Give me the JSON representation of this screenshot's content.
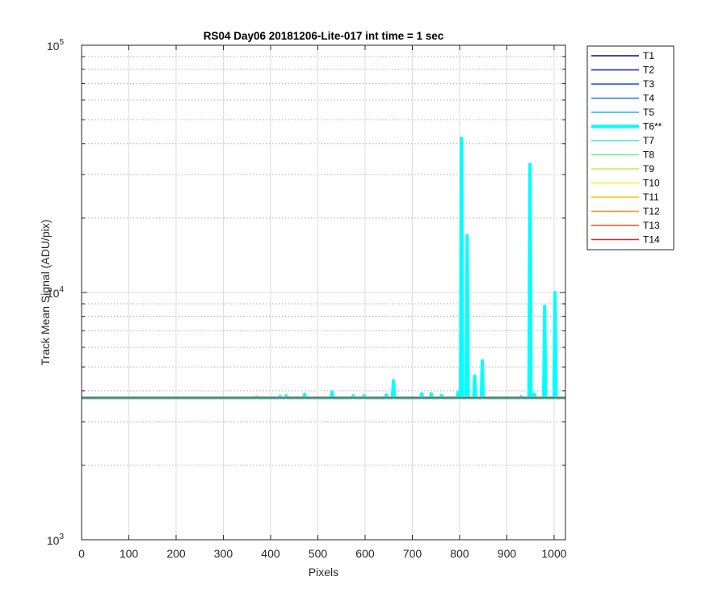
{
  "chart_data": {
    "type": "line",
    "title": "RS04 Day06 20181206-Lite-017 int time = 1 sec",
    "xlabel": "Pixels",
    "ylabel": "Track Mean Signal (ADU/pix)",
    "xlim": [
      0,
      1024
    ],
    "ylim": [
      1000,
      100000
    ],
    "yscale": "log",
    "grid": true,
    "minor_grid": true,
    "legend_position": "outside-right",
    "x_ticks": [
      "0",
      "100",
      "200",
      "300",
      "400",
      "500",
      "600",
      "700",
      "800",
      "900",
      "1000"
    ],
    "y_ticks": [
      {
        "base": "10",
        "exp": "3",
        "value": 1000
      },
      {
        "base": "10",
        "exp": "4",
        "value": 10000
      },
      {
        "base": "10",
        "exp": "5",
        "value": 100000
      }
    ],
    "baseline_level": 3750,
    "series": [
      {
        "name": "T1",
        "color": "#0b0b8f",
        "width": 1.5,
        "values": "baseline"
      },
      {
        "name": "T2",
        "color": "#1020c8",
        "width": 1.5,
        "values": "baseline"
      },
      {
        "name": "T3",
        "color": "#1a4fdc",
        "width": 1.5,
        "values": "baseline"
      },
      {
        "name": "T4",
        "color": "#1f82e6",
        "width": 1.5,
        "values": "baseline"
      },
      {
        "name": "T5",
        "color": "#25b4ef",
        "width": 1.5,
        "values": "baseline"
      },
      {
        "name": "T6**",
        "color": "#00ffff",
        "width": 4,
        "peaks": [
          [
            370,
            3780
          ],
          [
            420,
            3800
          ],
          [
            433,
            3820
          ],
          [
            472,
            3880
          ],
          [
            530,
            3960
          ],
          [
            575,
            3820
          ],
          [
            598,
            3830
          ],
          [
            645,
            3860
          ],
          [
            660,
            4400
          ],
          [
            720,
            3900
          ],
          [
            740,
            3900
          ],
          [
            762,
            3840
          ],
          [
            797,
            3950
          ],
          [
            804,
            42000
          ],
          [
            816,
            17000
          ],
          [
            832,
            4600
          ],
          [
            848,
            5300
          ],
          [
            930,
            3790
          ],
          [
            949,
            33000
          ],
          [
            958,
            3880
          ],
          [
            980,
            8800
          ],
          [
            1002,
            10000
          ]
        ]
      },
      {
        "name": "T7",
        "color": "#3fe0c8",
        "width": 1.5,
        "values": "baseline"
      },
      {
        "name": "T8",
        "color": "#6cf08a",
        "width": 1.5,
        "values": "baseline"
      },
      {
        "name": "T9",
        "color": "#b8f24a",
        "width": 1.5,
        "values": "baseline"
      },
      {
        "name": "T10",
        "color": "#f3f21a",
        "width": 1.5,
        "values": "baseline"
      },
      {
        "name": "T11",
        "color": "#f4c21a",
        "width": 1.5,
        "values": "baseline"
      },
      {
        "name": "T12",
        "color": "#f08c1e",
        "width": 1.5,
        "values": "baseline"
      },
      {
        "name": "T13",
        "color": "#f04f1f",
        "width": 1.5,
        "values": "baseline"
      },
      {
        "name": "T14",
        "color": "#e8221c",
        "width": 1.5,
        "values": "baseline"
      }
    ]
  }
}
